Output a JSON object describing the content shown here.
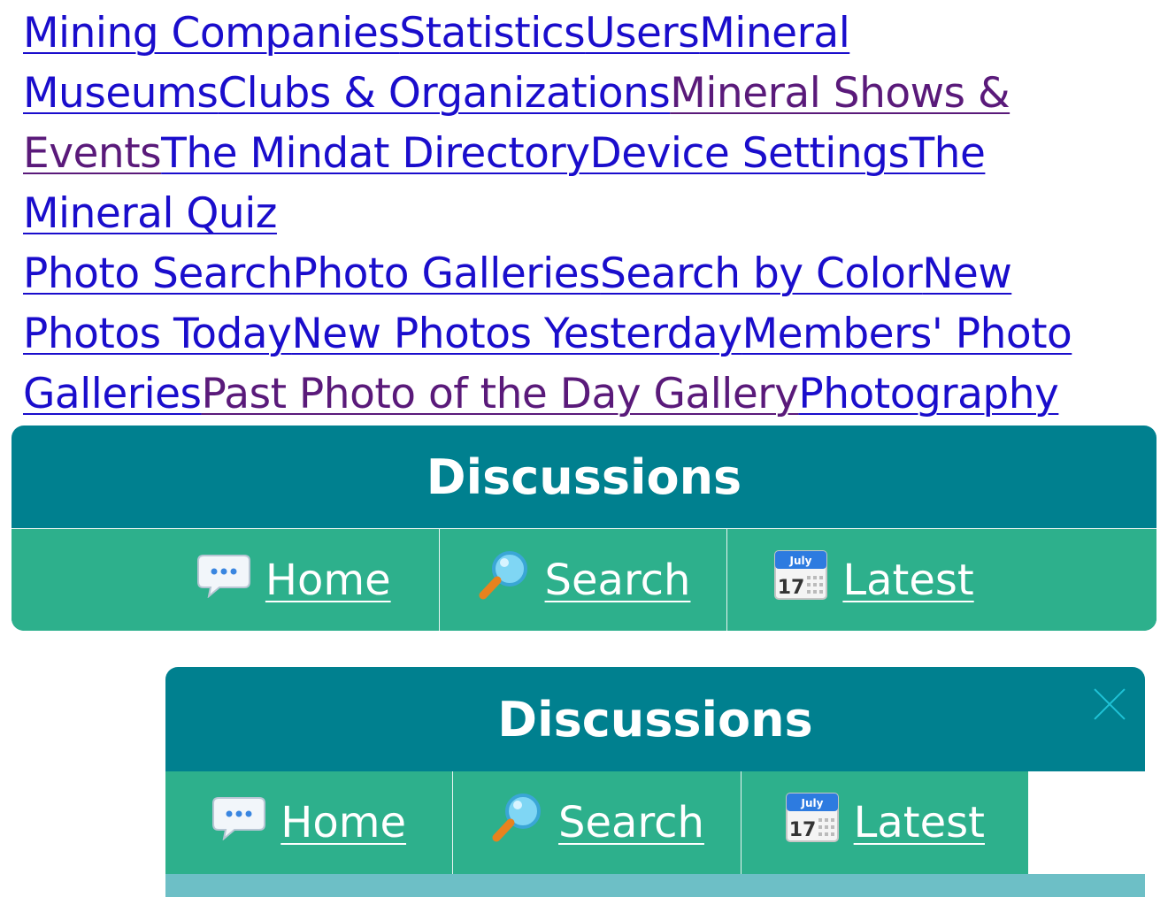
{
  "nav_links": [
    {
      "label": "Mining Companies",
      "visited": false
    },
    {
      "label": "Statistics",
      "visited": false
    },
    {
      "label": "Users",
      "visited": false
    },
    {
      "label": "Mineral Museums",
      "visited": false
    },
    {
      "label": "Clubs & Organizations",
      "visited": false
    },
    {
      "label": "Mineral Shows & Events",
      "visited": true
    },
    {
      "label": "The Mindat Directory",
      "visited": false
    },
    {
      "label": "Device Settings",
      "visited": false
    },
    {
      "label": "The Mineral Quiz",
      "visited": false
    }
  ],
  "photo_links": [
    {
      "label": "Photo Search",
      "visited": false
    },
    {
      "label": "Photo Galleries",
      "visited": false
    },
    {
      "label": "Search by Color",
      "visited": false
    },
    {
      "label": "New Photos Today",
      "visited": false
    },
    {
      "label": "New Photos Yesterday",
      "visited": false
    },
    {
      "label": "Members' Photo Galleries",
      "visited": false
    },
    {
      "label": "Past Photo of the Day Gallery",
      "visited": true
    },
    {
      "label": "Photography",
      "visited": false
    }
  ],
  "discussions_panel": {
    "title": "Discussions",
    "buttons": [
      {
        "label": "Home",
        "icon": "speech-bubble-icon"
      },
      {
        "label": "Search",
        "icon": "magnifier-icon"
      },
      {
        "label": "Latest",
        "icon": "calendar-icon"
      }
    ]
  },
  "discussions_popup": {
    "title": "Discussions",
    "close_icon": "close-icon",
    "buttons": [
      {
        "label": "Home",
        "icon": "speech-bubble-icon"
      },
      {
        "label": "Search",
        "icon": "magnifier-icon"
      },
      {
        "label": "Latest",
        "icon": "calendar-icon"
      }
    ],
    "calendar_month": "July",
    "calendar_day": "17"
  },
  "colors": {
    "link": "#1a0dcc",
    "visited_link": "#5a1a7a",
    "panel_header": "#00808f",
    "panel_bar": "#2db08c",
    "close_icon": "#1fc2d6"
  }
}
